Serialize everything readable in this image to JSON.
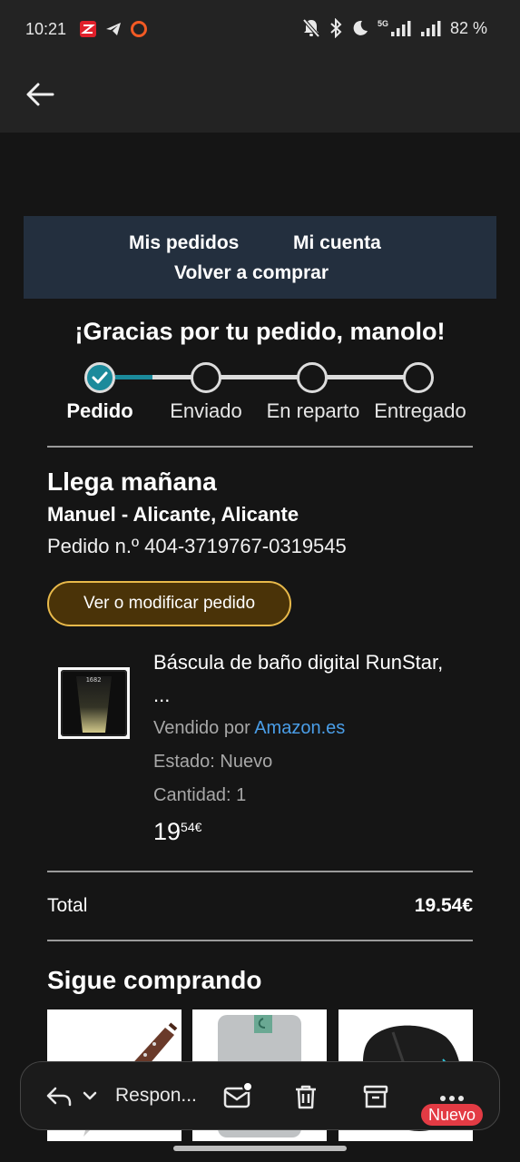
{
  "status_bar": {
    "time": "10:21",
    "network_label": "5G",
    "battery": "82 %",
    "icons": [
      "zoho-app-icon",
      "telegram-icon",
      "record-icon",
      "bell-off-icon",
      "bluetooth-icon",
      "moon-icon",
      "signal-icon",
      "signal-icon",
      "battery-text"
    ]
  },
  "app_bar": {
    "back_icon": "arrow-left-icon"
  },
  "email": {
    "nav": {
      "my_orders": "Mis pedidos",
      "my_account": "Mi cuenta",
      "buy_again": "Volver a comprar"
    },
    "thanks_title": "¡Gracias por tu pedido, manolo!",
    "tracker": {
      "steps": [
        "Pedido",
        "Enviado",
        "En reparto",
        "Entregado"
      ],
      "current_step": 1,
      "accent": "#1b8a9b"
    },
    "arrival_title": "Llega mañana",
    "address": "Manuel - Alicante, Alicante",
    "order_number": "Pedido n.º 404-3719767-0319545",
    "modify_button": "Ver o modificar pedido",
    "product": {
      "name": "Báscula de baño digital RunStar, ...",
      "sold_by_prefix": "Vendido por ",
      "seller": "Amazon.es",
      "condition": "Estado: Nuevo",
      "quantity": "Cantidad: 1",
      "price_int": "19",
      "price_dec": "54€",
      "thumb_display": "1682"
    },
    "total": {
      "label": "Total",
      "value": "19.54€"
    },
    "keep_shopping": "Sigue comprando",
    "recommendations": [
      "knife-product",
      "hard-drive-product",
      "gaming-mouse-product"
    ]
  },
  "action_bar": {
    "reply_label": "Respon...",
    "new_badge": "Nuevo",
    "icons": [
      "reply-icon",
      "chevron-down-icon",
      "mark-unread-icon",
      "trash-icon",
      "archive-icon",
      "more-icon"
    ]
  },
  "colors": {
    "banner": "#232f3e",
    "button_bg": "#4a3308",
    "button_border": "#e8b94a",
    "link": "#4a9ee8",
    "badge": "#e33b44"
  }
}
